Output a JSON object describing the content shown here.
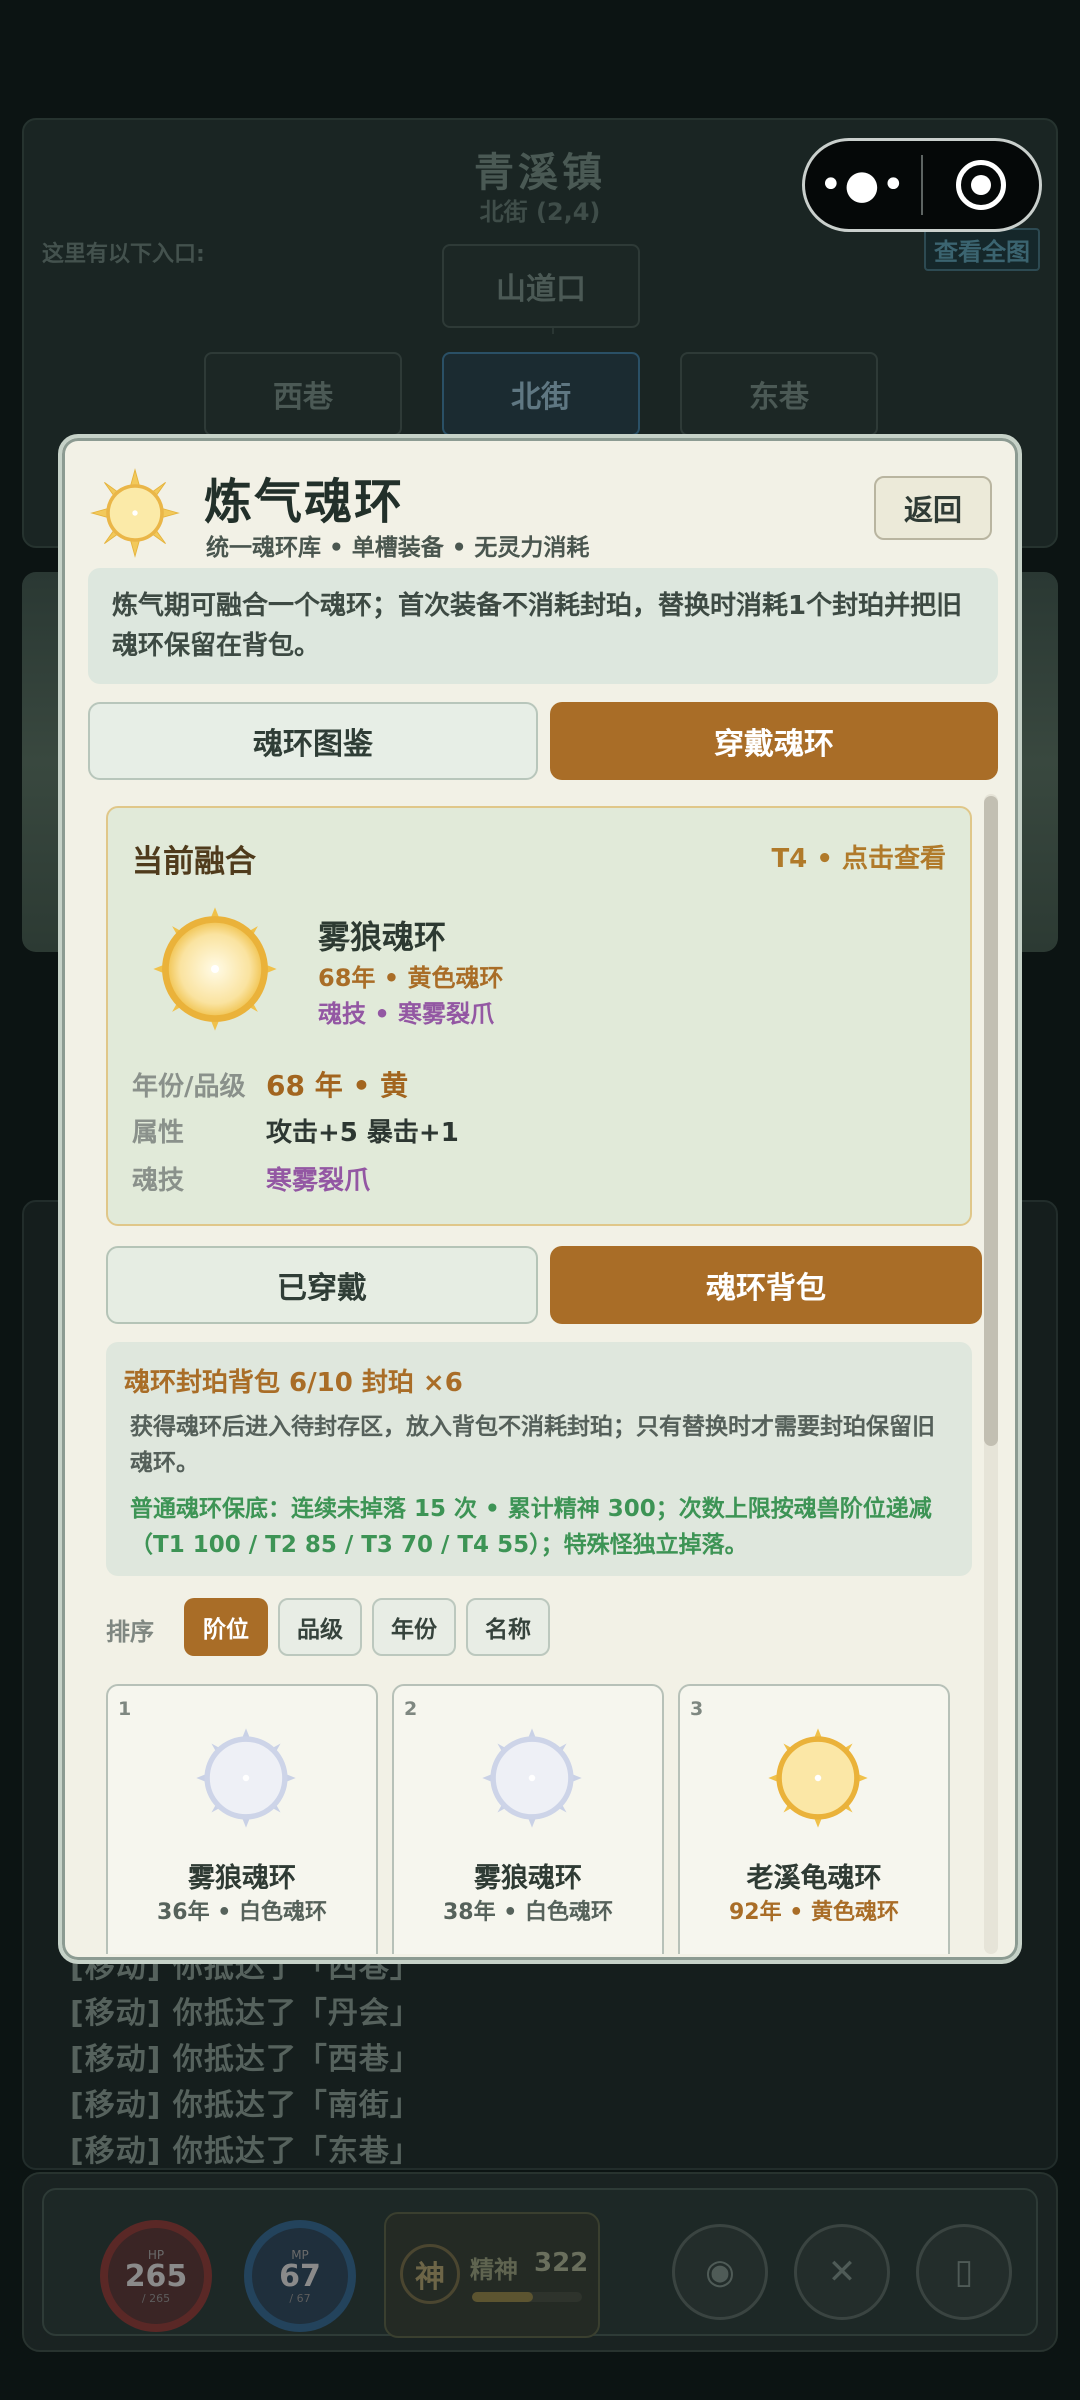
{
  "map": {
    "town": "青溪镇",
    "coord": "北街 (2,4)",
    "entries_label": "这里有以下入口:",
    "view_all": "查看全图",
    "nodes": {
      "north_gate": "山道口",
      "west": "西巷",
      "center": "北街",
      "east": "东巷"
    }
  },
  "log": [
    "[移动] 你抵达了「西巷」",
    "[移动] 你抵达了「丹会」",
    "[移动] 你抵达了「西巷」",
    "[移动] 你抵达了「南街」",
    "[移动] 你抵达了「东巷」"
  ],
  "hud": {
    "hp": {
      "label": "HP",
      "value": "265",
      "sub": "/ 265"
    },
    "mp": {
      "label": "MP",
      "value": "67",
      "sub": "/ 67"
    },
    "spirit": {
      "seal": "神",
      "label": "精神",
      "value": "322",
      "fill_fraction": 0.55
    },
    "icons": [
      "bag-icon",
      "battle-icon",
      "phone-icon"
    ]
  },
  "modal": {
    "title": "炼气魂环",
    "subtitle": "统一魂环库 • 单槽装备 • 无灵力消耗",
    "back": "返回",
    "intro": "炼气期可融合一个魂环；首次装备不消耗封珀，替换时消耗1个封珀并把旧魂环保留在背包。",
    "tabs": [
      "魂环图鉴",
      "穿戴魂环"
    ],
    "current": {
      "heading": "当前融合",
      "link": "T4 • 点击查看",
      "name": "雾狼魂环",
      "line1": "68年 • 黄色魂环",
      "line2": "魂技 • 寒雾裂爪",
      "rows": [
        {
          "key": "年份/品级",
          "value": "68 年 • 黄"
        },
        {
          "key": "属性",
          "value": "攻击+5  暴击+1"
        },
        {
          "key": "魂技",
          "value": "寒雾裂爪"
        }
      ]
    },
    "worn_button": "已穿戴",
    "bag_button": "魂环背包",
    "bag": {
      "title": "魂环封珀背包  6/10    封珀 ×6",
      "desc": "获得魂环后进入待封存区，放入背包不消耗封珀；只有替换时才需要封珀保留旧魂环。",
      "guard": "普通魂环保底：连续未掉落 15 次 • 累计精神 300；次数上限按魂兽阶位递减（T1 100 / T2 85 / T3 70 / T4 55）；特殊怪独立掉落。"
    },
    "sort": {
      "label": "排序",
      "options": [
        "阶位",
        "品级",
        "年份",
        "名称"
      ],
      "active": "阶位"
    },
    "rings": [
      {
        "index": "1",
        "name": "雾狼魂环",
        "sub": "36年 • 白色魂环",
        "color": "white"
      },
      {
        "index": "2",
        "name": "雾狼魂环",
        "sub": "38年 • 白色魂环",
        "color": "white"
      },
      {
        "index": "3",
        "name": "老溪龟魂环",
        "sub": "92年 • 黄色魂环",
        "color": "yellow"
      }
    ]
  },
  "colors": {
    "accent": "#a96d27",
    "panel": "#f2f1e6",
    "soft_green": "#dde7de",
    "purple": "#9357a3",
    "guard_green": "#3d9455"
  }
}
